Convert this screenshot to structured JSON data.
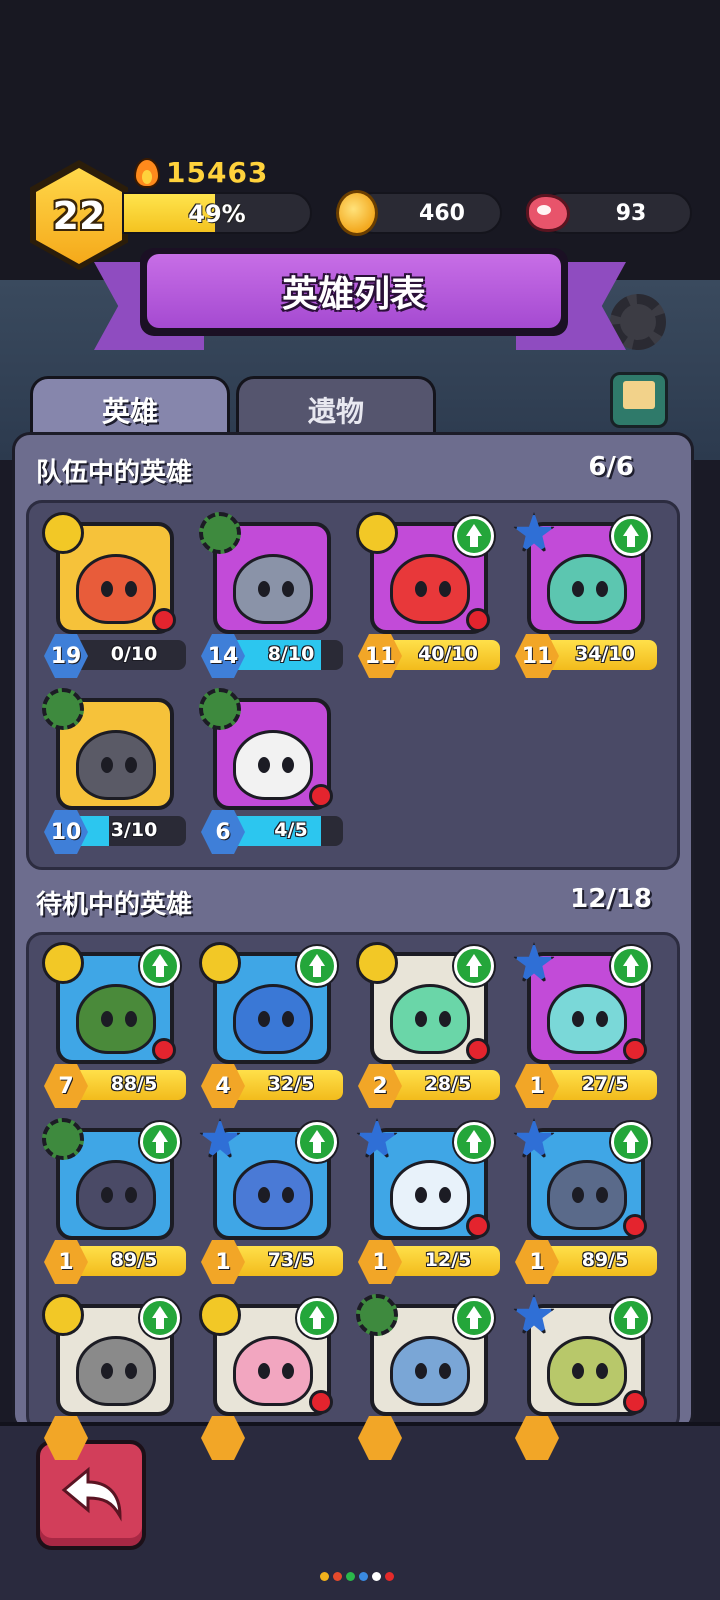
{
  "hud": {
    "level": "22",
    "power": "15463",
    "xp_percent_label": "49%",
    "xp_fraction": 0.49,
    "coins": "460",
    "meat": "93"
  },
  "title": "英雄列表",
  "tabs": {
    "heroes": "英雄",
    "relics": "遗物"
  },
  "team": {
    "title": "队伍中的英雄",
    "count": "6/6",
    "heroes": [
      {
        "level": "19",
        "progress": "0/10",
        "fill": 0.0,
        "bar": "blue",
        "cls": "skull",
        "bg": "#f6c23a",
        "face": "#e85c3a",
        "upgrade": false,
        "alert": true
      },
      {
        "level": "14",
        "progress": "8/10",
        "fill": 0.8,
        "bar": "blue",
        "cls": "gear",
        "bg": "#c24bd8",
        "face": "#8a93a8",
        "upgrade": false,
        "alert": false
      },
      {
        "level": "11",
        "progress": "40/10",
        "fill": 1.0,
        "bar": "gold",
        "cls": "skull",
        "bg": "#c24bd8",
        "face": "#e8383a",
        "upgrade": true,
        "alert": true
      },
      {
        "level": "11",
        "progress": "34/10",
        "fill": 1.0,
        "bar": "gold",
        "cls": "star",
        "bg": "#c24bd8",
        "face": "#5cc6b0",
        "upgrade": true,
        "alert": false
      },
      {
        "level": "10",
        "progress": "3/10",
        "fill": 0.3,
        "bar": "blue",
        "cls": "gear",
        "bg": "#f6c23a",
        "face": "#5a5a66",
        "upgrade": false,
        "alert": false
      },
      {
        "level": "6",
        "progress": "4/5",
        "fill": 0.8,
        "bar": "blue",
        "cls": "gear",
        "bg": "#c24bd8",
        "face": "#f2f2f2",
        "upgrade": false,
        "alert": true
      }
    ]
  },
  "standby": {
    "title": "待机中的英雄",
    "count": "12/18",
    "heroes": [
      {
        "level": "7",
        "progress": "88/5",
        "fill": 1.0,
        "bar": "gold",
        "cls": "skull",
        "bg": "#3fa6e6",
        "face": "#4a8a3a",
        "upgrade": true,
        "alert": true
      },
      {
        "level": "4",
        "progress": "32/5",
        "fill": 1.0,
        "bar": "gold",
        "cls": "skull",
        "bg": "#3fa6e6",
        "face": "#3a78d6",
        "upgrade": true,
        "alert": false
      },
      {
        "level": "2",
        "progress": "28/5",
        "fill": 1.0,
        "bar": "gold",
        "cls": "skull",
        "bg": "#e8e4d8",
        "face": "#6ad6a8",
        "upgrade": true,
        "alert": true
      },
      {
        "level": "1",
        "progress": "27/5",
        "fill": 1.0,
        "bar": "gold",
        "cls": "star",
        "bg": "#c24bd8",
        "face": "#7ad8d8",
        "upgrade": true,
        "alert": true
      },
      {
        "level": "1",
        "progress": "89/5",
        "fill": 1.0,
        "bar": "gold",
        "cls": "gear",
        "bg": "#3fa6e6",
        "face": "#4a4a66",
        "upgrade": true,
        "alert": false
      },
      {
        "level": "1",
        "progress": "73/5",
        "fill": 1.0,
        "bar": "gold",
        "cls": "star",
        "bg": "#3fa6e6",
        "face": "#4a7ad6",
        "upgrade": true,
        "alert": false
      },
      {
        "level": "1",
        "progress": "12/5",
        "fill": 1.0,
        "bar": "gold",
        "cls": "star",
        "bg": "#3fa6e6",
        "face": "#e8f2fa",
        "upgrade": true,
        "alert": true
      },
      {
        "level": "1",
        "progress": "89/5",
        "fill": 1.0,
        "bar": "gold",
        "cls": "star",
        "bg": "#3fa6e6",
        "face": "#5a6a8a",
        "upgrade": true,
        "alert": true
      },
      {
        "level": "",
        "progress": "",
        "fill": 1.0,
        "bar": "gold",
        "cls": "skull",
        "bg": "#e8e4d8",
        "face": "#8a8a8a",
        "upgrade": true,
        "alert": false
      },
      {
        "level": "",
        "progress": "",
        "fill": 1.0,
        "bar": "gold",
        "cls": "skull",
        "bg": "#e8e4d8",
        "face": "#f2a6c0",
        "upgrade": true,
        "alert": true
      },
      {
        "level": "",
        "progress": "",
        "fill": 1.0,
        "bar": "gold",
        "cls": "gear",
        "bg": "#e8e4d8",
        "face": "#7aa6d6",
        "upgrade": true,
        "alert": false
      },
      {
        "level": "",
        "progress": "",
        "fill": 1.0,
        "bar": "gold",
        "cls": "star",
        "bg": "#e8e4d8",
        "face": "#b8c86a",
        "upgrade": true,
        "alert": true
      }
    ]
  },
  "icons": {
    "back": "back-arrow-icon",
    "settings": "gear-icon",
    "mail": "mail-icon",
    "coin": "coin-icon",
    "meat": "meat-icon",
    "power": "flame-icon"
  },
  "page_dots": [
    "#f2b21c",
    "#e44a2c",
    "#2ab84a",
    "#3a8ae0",
    "#ffffff",
    "#e42a2a"
  ]
}
